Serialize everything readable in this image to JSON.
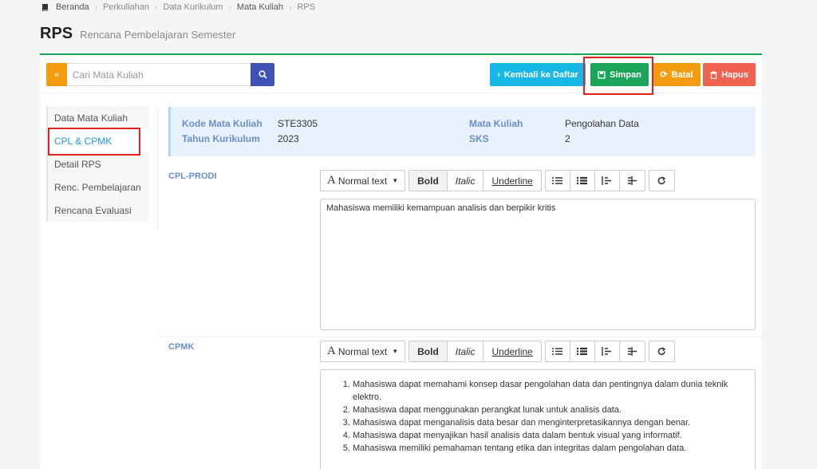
{
  "breadcrumb": [
    "Beranda",
    "Perkuliahan",
    "Data Kurikulum",
    "Mata Kuliah",
    "RPS"
  ],
  "page": {
    "title": "RPS",
    "subtitle": "Rencana Pembelajaran Semester"
  },
  "search": {
    "placeholder": "Cari Mata Kuliah",
    "toggle_label": "«"
  },
  "actions": {
    "back": "Kembali ke Daftar",
    "save": "Simpan",
    "cancel": "Batal",
    "delete": "Hapus"
  },
  "sidebar": {
    "items": [
      {
        "label": "Data Mata Kuliah"
      },
      {
        "label": "CPL & CPMK"
      },
      {
        "label": "Detail RPS"
      },
      {
        "label": "Renc. Pembelajaran"
      },
      {
        "label": "Rencana Evaluasi"
      }
    ]
  },
  "info": {
    "kode_label": "Kode Mata Kuliah",
    "kode_value": "STE3305",
    "tahun_label": "Tahun Kurikulum",
    "tahun_value": "2023",
    "matkul_label": "Mata Kuliah",
    "matkul_value": "Pengolahan Data",
    "sks_label": "SKS",
    "sks_value": "2"
  },
  "editor_toolbar": {
    "font": "Normal text",
    "bold": "Bold",
    "italic": "Italic",
    "underline": "Underline"
  },
  "cpl": {
    "label": "CPL-PRODI",
    "text": "Mahasiswa memiliki kemampuan analisis dan berpikir kritis"
  },
  "cpmk": {
    "label": "CPMK",
    "items": [
      "Mahasiswa dapat memahami konsep dasar pengolahan data dan pentingnya dalam dunia teknik elektro.",
      "Mahasiswa dapat menggunakan perangkat lunak untuk analisis data.",
      "Mahasiswa dapat menganalisis data besar dan menginterpretasikannya dengan benar.",
      "Mahasiswa dapat menyajikan hasil analisis data dalam bentuk visual yang informatif.",
      "Mahasiswa memiliki pemahaman tentang etika dan integritas dalam pengolahan data."
    ]
  },
  "colors": {
    "primary_green": "#1aa55a",
    "info_blue": "#17b8e6",
    "warning": "#f39c12",
    "danger": "#f0624f",
    "search_blue": "#3f51b5",
    "highlight_red": "#e2201c"
  }
}
